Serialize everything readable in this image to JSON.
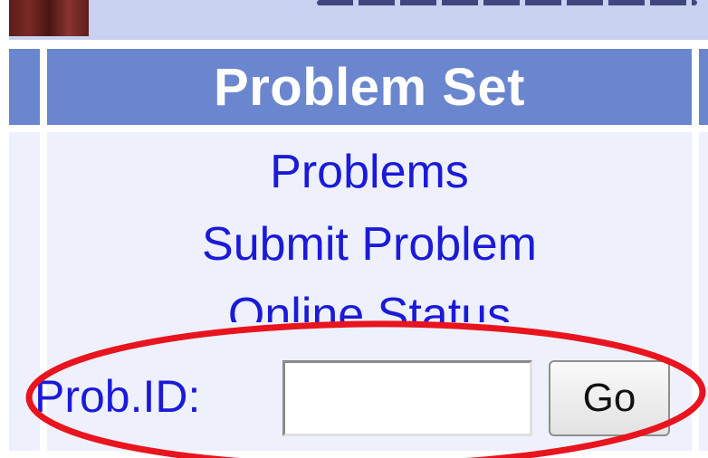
{
  "panel": {
    "title": "Problem Set",
    "links": [
      "Problems",
      "Submit Problem",
      "Online Status"
    ]
  },
  "search": {
    "label": "Prob.ID:",
    "value": "",
    "button_label": "Go"
  },
  "colors": {
    "header_bg": "#6a86cf",
    "panel_bg": "#eef0fb",
    "link": "#1a1ad8",
    "annotation": "#e8141e"
  }
}
